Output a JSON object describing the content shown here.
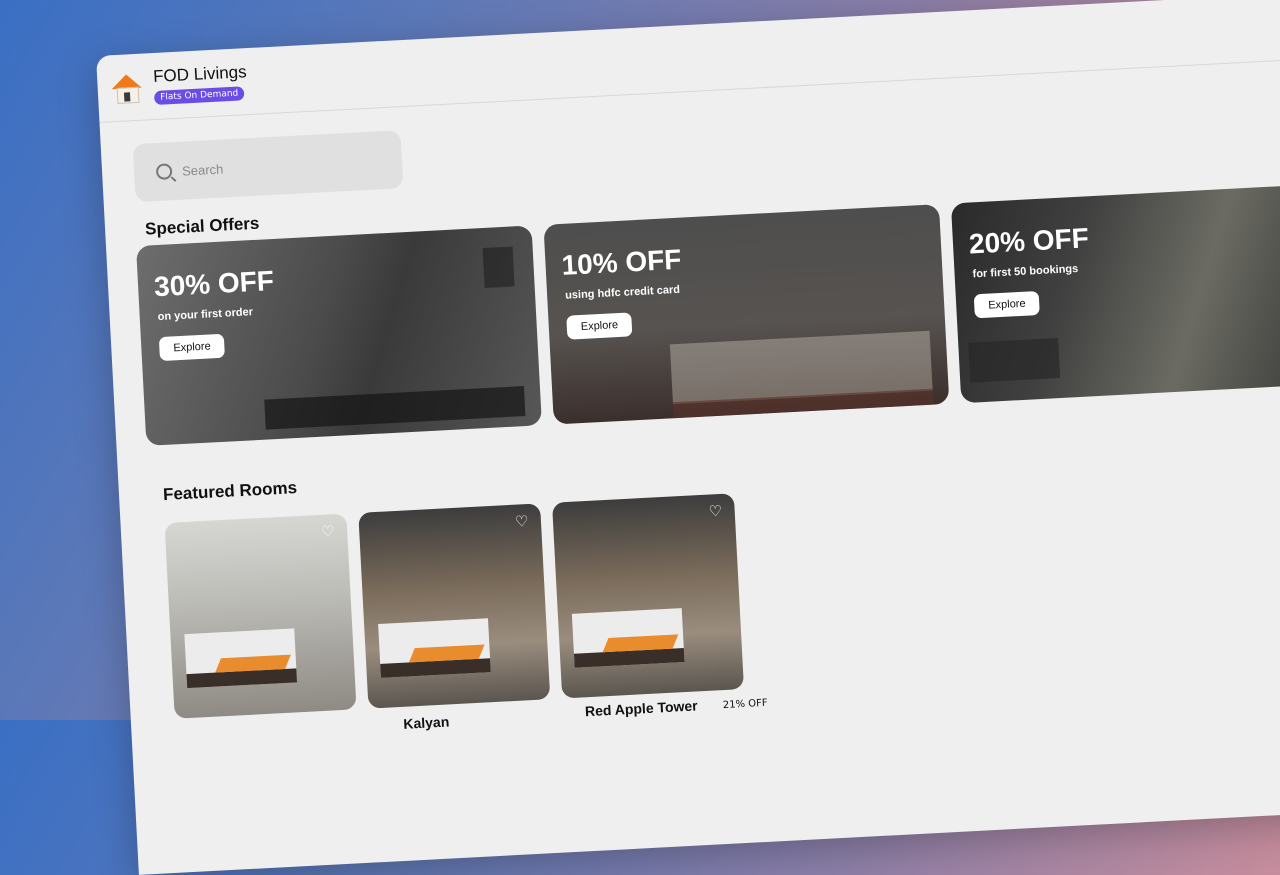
{
  "app": {
    "name": "FOD Livings",
    "tagline": "Flats On Demand"
  },
  "search": {
    "placeholder": "Search"
  },
  "special_offers": {
    "title": "Special Offers",
    "items": [
      {
        "discount": "30% OFF",
        "subtitle": "on your first order",
        "button": "Explore"
      },
      {
        "discount": "10% OFF",
        "subtitle": "using hdfc credit card",
        "button": "Explore"
      },
      {
        "discount": "20% OFF",
        "subtitle": "for first 50 bookings",
        "button": "Explore"
      }
    ]
  },
  "featured_rooms": {
    "title": "Featured Rooms",
    "items": [
      {
        "name": ""
      },
      {
        "name": "Kalyan"
      },
      {
        "name": "Red Apple Tower",
        "discount": "21% OFF"
      }
    ]
  },
  "colors": {
    "accent": "#6a4ce6",
    "logo_orange": "#f07a1a",
    "background": "#efefef"
  }
}
